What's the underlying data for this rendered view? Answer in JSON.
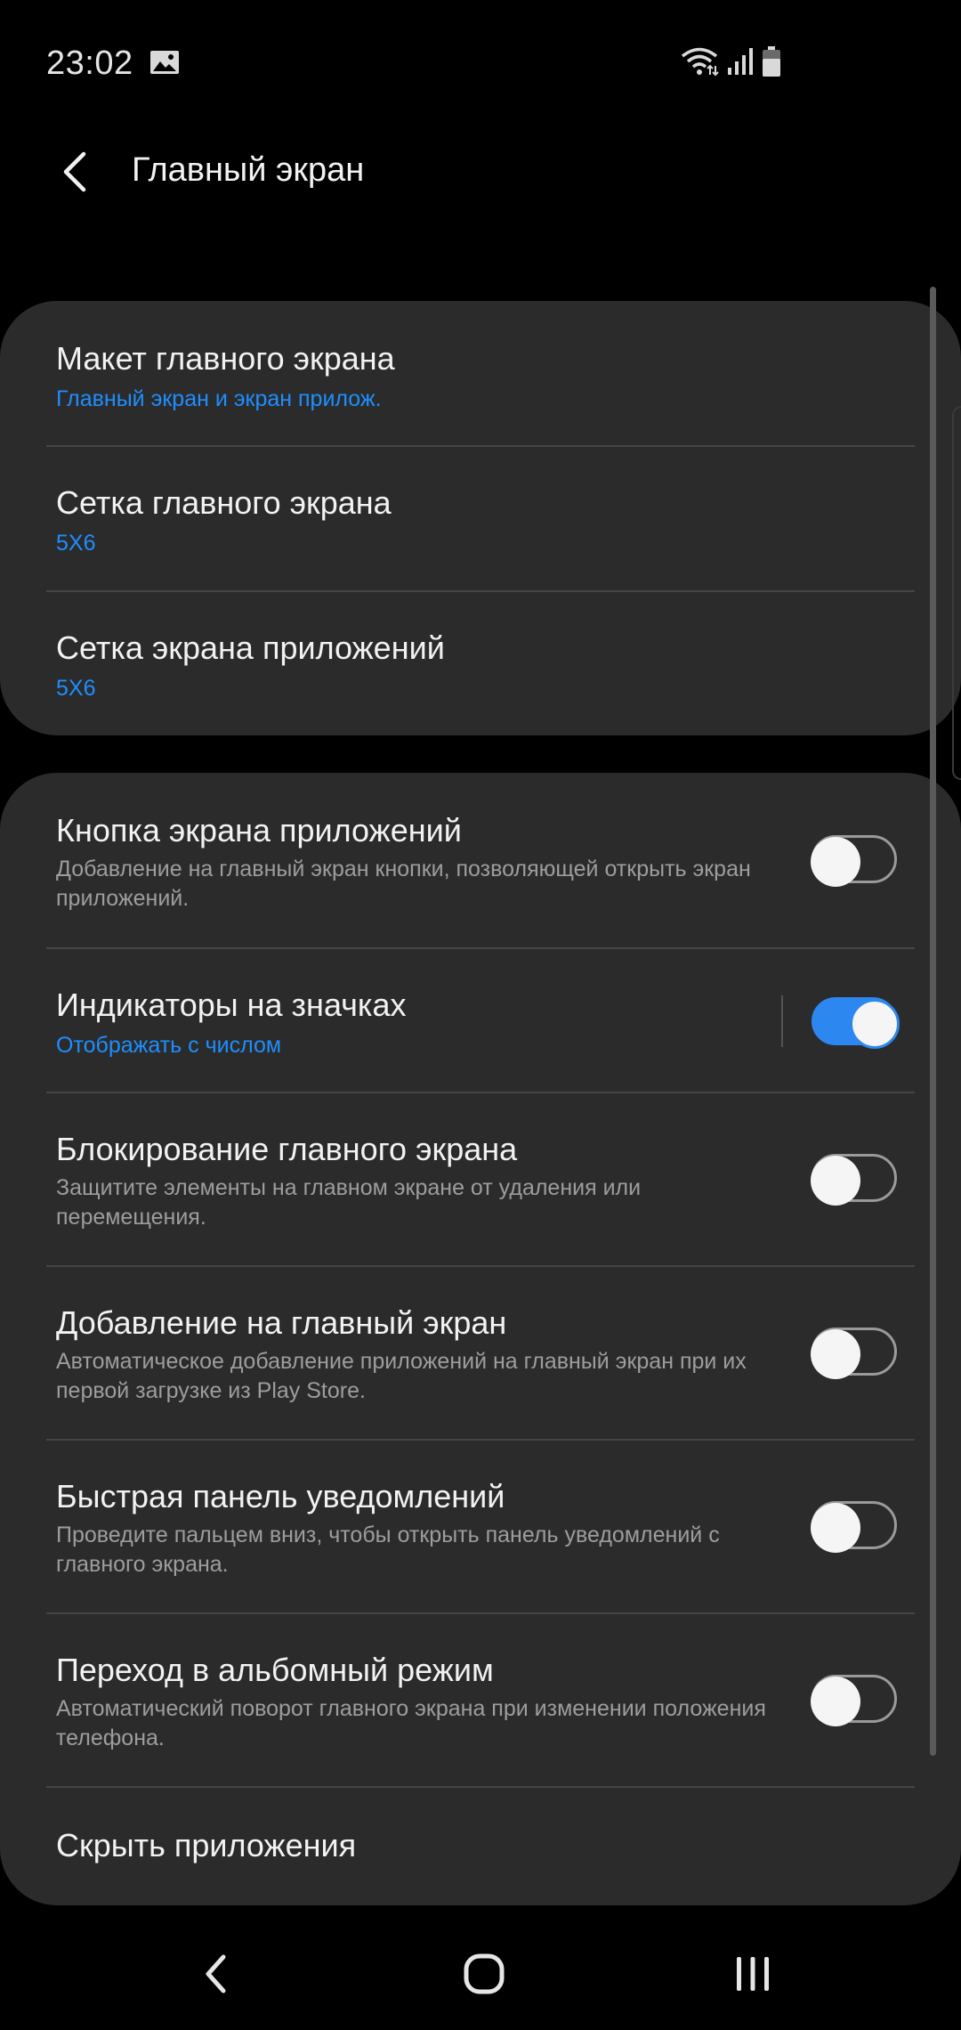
{
  "status_bar": {
    "time": "23:02",
    "icons": [
      "gallery-icon",
      "wifi-icon",
      "signal-icon",
      "battery-icon"
    ]
  },
  "header": {
    "title": "Главный экран",
    "back_icon": "chevron-left-icon"
  },
  "groups": [
    {
      "items": [
        {
          "title": "Макет главного экрана",
          "subtitle": "Главный экран и экран прилож."
        },
        {
          "title": "Сетка главного экрана",
          "subtitle": "5X6"
        },
        {
          "title": "Сетка экрана приложений",
          "subtitle": "5X6"
        }
      ]
    },
    {
      "items": [
        {
          "title": "Кнопка экрана приложений",
          "description": "Добавление на главный экран кнопки, позволяющей открыть экран приложений.",
          "toggle": false
        },
        {
          "title": "Индикаторы на значках",
          "subtitle": "Отображать с числом",
          "toggle": true
        },
        {
          "title": "Блокирование главного экрана",
          "description": "Защитите элементы на главном экране от удаления или перемещения.",
          "toggle": false
        },
        {
          "title": "Добавление на главный экран",
          "description": "Автоматическое добавление приложений на главный экран при их первой загрузке из Play Store.",
          "toggle": false
        },
        {
          "title": "Быстрая панель уведомлений",
          "description": "Проведите пальцем вниз, чтобы открыть панель уведомлений с главного экрана.",
          "toggle": false
        },
        {
          "title": "Переход в альбомный режим",
          "description": "Автоматический поворот главного экрана при изменении положения телефона.",
          "toggle": false
        },
        {
          "title": "Скрыть приложения"
        }
      ]
    }
  ],
  "colors": {
    "background": "#000000",
    "card": "#2b2b2b",
    "accent": "#1e8eff",
    "toggle_on": "#2d87f0",
    "secondary_text": "#9d9d9d"
  },
  "nav_bar": {
    "icons": [
      "back-nav-icon",
      "home-nav-icon",
      "recents-nav-icon"
    ]
  }
}
